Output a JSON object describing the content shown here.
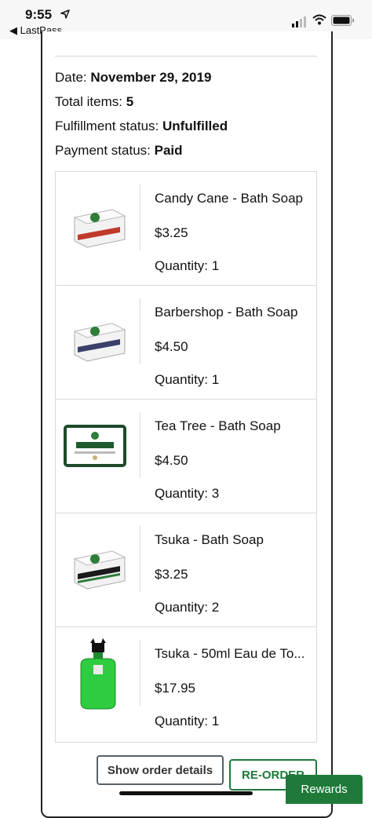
{
  "status_bar": {
    "time": "9:55",
    "back_app": "◀ LastPass"
  },
  "order": {
    "date_label": "Date:",
    "date_value": "November 29, 2019",
    "total_label": "Total items:",
    "total_value": "5",
    "fulfillment_label": "Fulfillment status:",
    "fulfillment_value": "Unfulfilled",
    "payment_label": "Payment status:",
    "payment_value": "Paid"
  },
  "items": [
    {
      "name": "Candy Cane - Bath Soap",
      "price": "$3.25",
      "quantity": "Quantity: 1",
      "icon": "soap-box-icon",
      "band_color": "#c0392b"
    },
    {
      "name": "Barbershop - Bath Soap",
      "price": "$4.50",
      "quantity": "Quantity: 1",
      "icon": "soap-box-icon",
      "band_color": "#3a3f6b"
    },
    {
      "name": "Tea Tree - Bath Soap",
      "price": "$4.50",
      "quantity": "Quantity: 3",
      "icon": "soap-box-icon",
      "band_color": "#1e5a2e"
    },
    {
      "name": "Tsuka - Bath Soap",
      "price": "$3.25",
      "quantity": "Quantity: 2",
      "icon": "soap-box-icon",
      "band_color": "#1a1a1a"
    },
    {
      "name": "Tsuka - 50ml Eau de To...",
      "price": "$17.95",
      "quantity": "Quantity: 1",
      "icon": "cologne-bottle-icon",
      "band_color": "#2ecc40"
    }
  ],
  "buttons": {
    "show_details": "Show order details",
    "reorder": "RE-ORDER",
    "rewards": "Rewards"
  }
}
